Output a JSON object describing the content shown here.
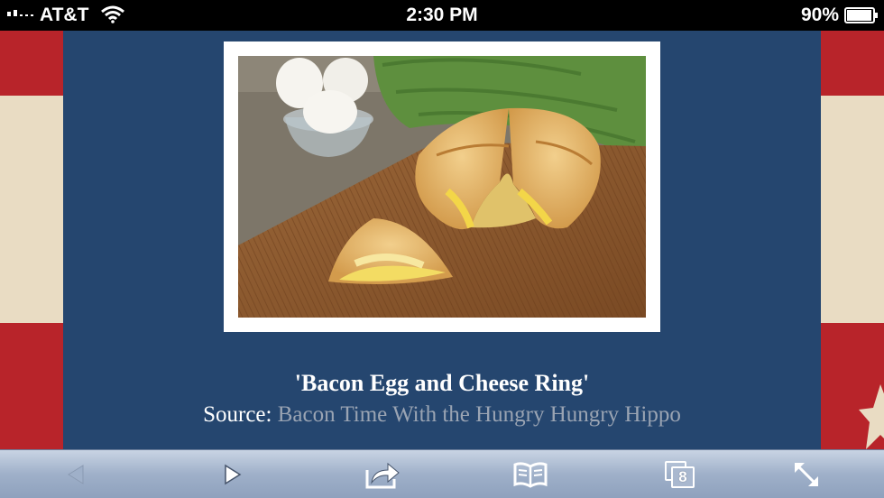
{
  "status_bar": {
    "carrier": "AT&T",
    "time": "2:30 PM",
    "battery": "90%",
    "icons": [
      "signal-bars-icon",
      "wifi-icon",
      "battery-icon"
    ]
  },
  "article": {
    "image_alt": "Bacon Egg and Cheese Ring",
    "title": "'Bacon Egg and Cheese Ring'",
    "source_label": "Source:",
    "source_link": "Bacon Time With the Hungry Hungry Hippo"
  },
  "toolbar": {
    "tabs_count": "8",
    "icons": [
      "back-icon",
      "forward-icon",
      "share-icon",
      "bookmarks-icon",
      "tabs-icon",
      "fullscreen-icon"
    ]
  },
  "colors": {
    "page_background": "#25466f",
    "flag_red": "#b8242a",
    "flag_cream": "#e9dcc3",
    "link_gray": "#9aa4b3"
  }
}
